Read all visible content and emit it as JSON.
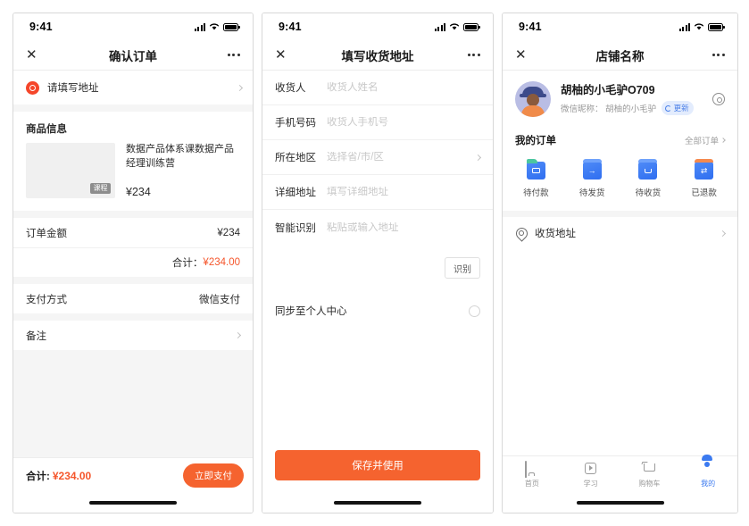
{
  "status_bar": {
    "time": "9:41",
    "signal_icon": "signal-bars-icon",
    "wifi_icon": "wifi-icon",
    "battery_icon": "battery-icon"
  },
  "colors": {
    "accent_orange": "#f5632f",
    "price_red": "#f5562c",
    "brand_blue": "#3b7af0",
    "pin_red": "#f5462a"
  },
  "screen1": {
    "nav": {
      "close": "✕",
      "title": "确认订单",
      "more": "more-icon"
    },
    "address": {
      "label": "请填写地址",
      "icon": "location-pin-icon"
    },
    "product_section_title": "商品信息",
    "product": {
      "badge": "课程",
      "name": "数据产品体系课数据产品经理训练营",
      "price": "¥234"
    },
    "order_amount": {
      "label": "订单金额",
      "value": "¥234"
    },
    "total_row": {
      "label": "合计：",
      "value": "¥234.00"
    },
    "payment": {
      "label": "支付方式",
      "value": "微信支付"
    },
    "remark": {
      "label": "备注"
    },
    "bottom": {
      "total_label": "合计:",
      "total_value": "¥234.00",
      "pay_button": "立即支付"
    }
  },
  "screen2": {
    "nav": {
      "close": "✕",
      "title": "填写收货地址",
      "more": "more-icon"
    },
    "fields": [
      {
        "label": "收货人",
        "placeholder": "收货人姓名",
        "has_chevron": false
      },
      {
        "label": "手机号码",
        "placeholder": "收货人手机号",
        "has_chevron": false
      },
      {
        "label": "所在地区",
        "placeholder": "选择省/市/区",
        "has_chevron": true
      },
      {
        "label": "详细地址",
        "placeholder": "填写详细地址",
        "has_chevron": false
      },
      {
        "label": "智能识别",
        "placeholder": "粘贴或输入地址",
        "has_chevron": false
      }
    ],
    "recognize_button": "识别",
    "sync": {
      "label": "同步至个人中心",
      "checked": false
    },
    "save_button": "保存并使用"
  },
  "screen3": {
    "nav": {
      "close": "✕",
      "title": "店铺名称",
      "more": "more-icon"
    },
    "profile": {
      "avatar": "user-avatar",
      "name": "胡柚的小毛驴O709",
      "nickname_label": "微信昵称： 胡柚的小毛驴",
      "update_pill": "更新",
      "settings_icon": "gear-icon"
    },
    "orders": {
      "title": "我的订单",
      "all_link": "全部订单",
      "items": [
        {
          "label": "待付款",
          "icon": "pending-payment-icon"
        },
        {
          "label": "待发货",
          "icon": "pending-shipment-icon"
        },
        {
          "label": "待收货",
          "icon": "pending-receipt-icon"
        },
        {
          "label": "已退款",
          "icon": "refunded-icon"
        }
      ]
    },
    "address_entry": {
      "label": "收货地址",
      "icon": "location-icon"
    },
    "tabs": [
      {
        "label": "首页",
        "icon": "home-icon",
        "active": false
      },
      {
        "label": "学习",
        "icon": "play-icon",
        "active": false
      },
      {
        "label": "购物车",
        "icon": "cart-icon",
        "active": false
      },
      {
        "label": "我的",
        "icon": "person-icon",
        "active": true
      }
    ]
  }
}
